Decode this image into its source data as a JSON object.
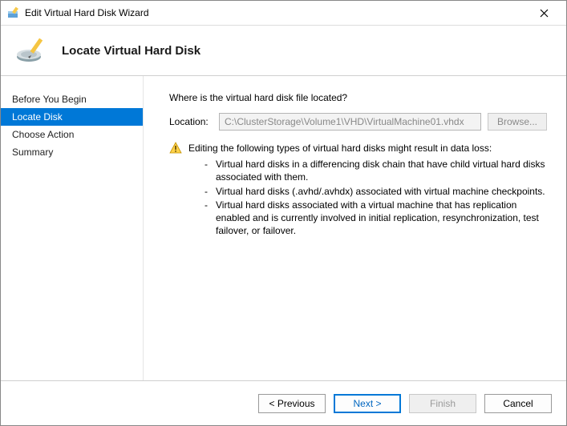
{
  "title": "Edit Virtual Hard Disk Wizard",
  "header": {
    "title": "Locate Virtual Hard Disk"
  },
  "sidebar": {
    "items": [
      {
        "label": "Before You Begin",
        "active": false
      },
      {
        "label": "Locate Disk",
        "active": true
      },
      {
        "label": "Choose Action",
        "active": false
      },
      {
        "label": "Summary",
        "active": false
      }
    ]
  },
  "content": {
    "question": "Where is the virtual hard disk file located?",
    "location_label": "Location:",
    "location_value": "C:\\ClusterStorage\\Volume1\\VHD\\VirtualMachine01.vhdx",
    "browse_label": "Browse...",
    "warning_intro": "Editing the following types of virtual hard disks might result in data loss:",
    "warning_items": [
      "Virtual hard disks in a differencing disk chain that have child virtual hard disks associated with them.",
      "Virtual hard disks (.avhd/.avhdx) associated with virtual machine checkpoints.",
      "Virtual hard disks associated with a virtual machine that has replication enabled and is currently involved in initial replication, resynchronization, test failover, or failover."
    ]
  },
  "footer": {
    "previous": "< Previous",
    "next": "Next >",
    "finish": "Finish",
    "cancel": "Cancel"
  }
}
